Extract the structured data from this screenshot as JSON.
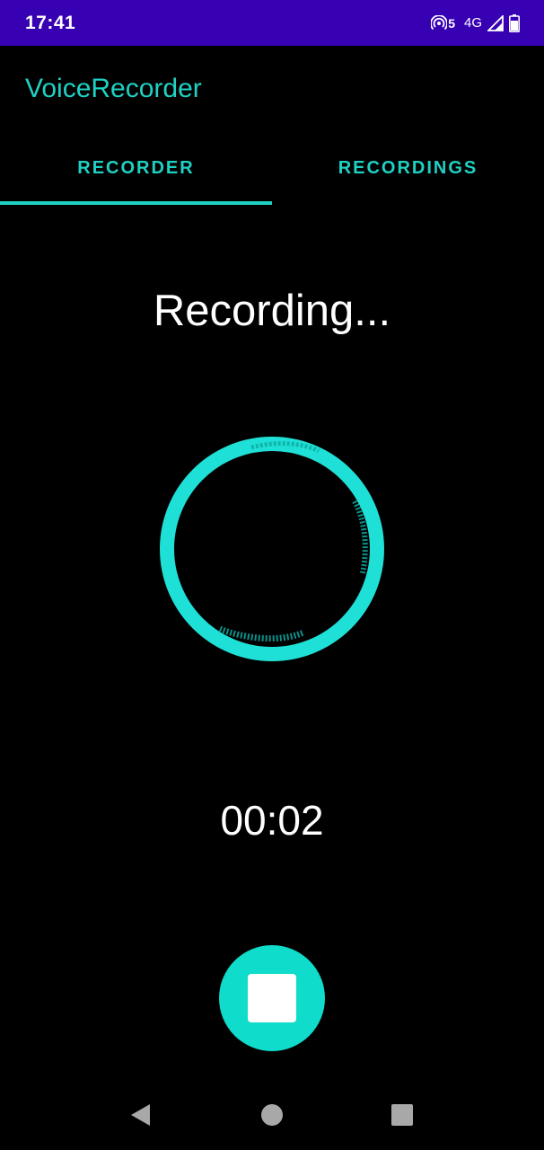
{
  "status_bar": {
    "time": "17:41",
    "hotspot_count": "5",
    "network": "4G"
  },
  "app": {
    "title": "VoiceRecorder"
  },
  "tabs": [
    {
      "label": "RECORDER",
      "selected": true
    },
    {
      "label": "RECORDINGS",
      "selected": false
    }
  ],
  "recorder": {
    "status_text": "Recording...",
    "timer": "00:02"
  },
  "icons": {
    "hotspot": "hotspot-icon",
    "signal": "signal-icon",
    "battery": "battery-icon",
    "stop": "stop-icon",
    "back": "back-triangle-icon",
    "home": "home-circle-icon",
    "recents": "recents-square-icon"
  },
  "colors": {
    "accent": "#1fd1c3",
    "status_bar": "#3700b3",
    "button": "#10dccb",
    "background": "#000000"
  }
}
